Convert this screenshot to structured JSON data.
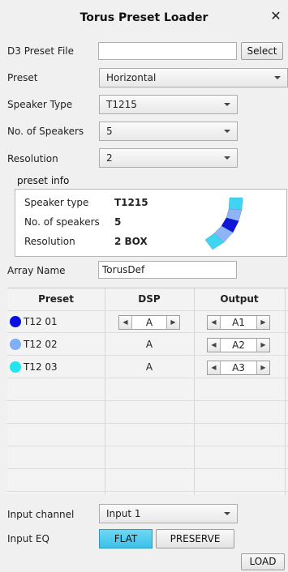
{
  "window": {
    "title": "Torus Preset Loader",
    "close_glyph": "✕"
  },
  "d3_preset_file": {
    "label": "D3 Preset File",
    "value": "",
    "button": "Select"
  },
  "preset": {
    "label": "Preset",
    "value": "Horizontal"
  },
  "speaker_type": {
    "label": "Speaker Type",
    "value": "T1215"
  },
  "num_speakers": {
    "label": "No. of Speakers",
    "value": "5"
  },
  "resolution": {
    "label": "Resolution",
    "value": "2"
  },
  "preset_info": {
    "title": "preset info",
    "speaker_type_label": "Speaker type",
    "speaker_type_value": "T1215",
    "num_speakers_label": "No. of speakers",
    "num_speakers_value": "5",
    "resolution_label": "Resolution",
    "resolution_value": "2 BOX",
    "icon": "torus-array-icon",
    "array_colors": [
      "#3fd4f2",
      "#8fb4f5",
      "#0f17d9",
      "#8fb4f5",
      "#3fd4f2"
    ]
  },
  "array_name": {
    "label": "Array Name",
    "value": "TorusDef"
  },
  "grid": {
    "headers": {
      "preset": "Preset",
      "dsp": "DSP",
      "output": "Output"
    },
    "rows": [
      {
        "color": "#0a10e0",
        "preset": "T12 01",
        "dsp": "A",
        "dsp_spinner": true,
        "output": "A1"
      },
      {
        "color": "#7fb0f5",
        "preset": "T12 02",
        "dsp": "A",
        "dsp_spinner": false,
        "output": "A2"
      },
      {
        "color": "#22e5f0",
        "preset": "T12 03",
        "dsp": "A",
        "dsp_spinner": false,
        "output": "A3"
      }
    ]
  },
  "input_channel": {
    "label": "Input channel",
    "value": "Input 1"
  },
  "input_eq": {
    "label": "Input EQ",
    "flat": "FLAT",
    "preserve": "PRESERVE"
  },
  "load_button": "LOAD"
}
